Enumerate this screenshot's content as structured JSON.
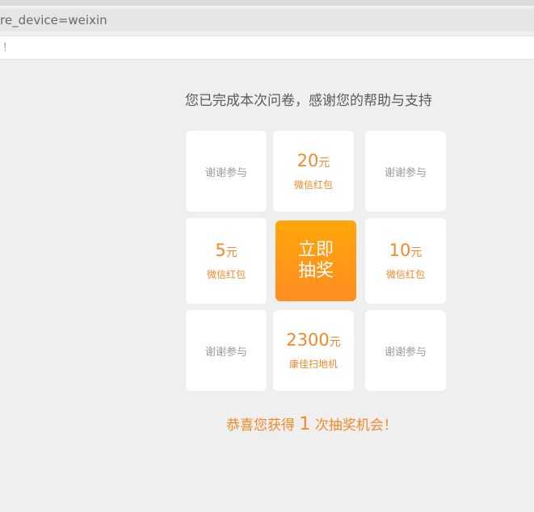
{
  "browser": {
    "url_fragment": "re_device=weixin",
    "info_text": "！"
  },
  "survey": {
    "title": "您已完成本次问卷，感谢您的帮助与支持"
  },
  "lottery": {
    "cells": {
      "top_left": {
        "text": "谢谢参与"
      },
      "top_middle": {
        "amount": "20",
        "unit": "元",
        "label": "微信红包"
      },
      "top_right": {
        "text": "谢谢参与"
      },
      "middle_left": {
        "amount": "5",
        "unit": "元",
        "label": "微信红包"
      },
      "middle_right": {
        "amount": "10",
        "unit": "元",
        "label": "微信红包"
      },
      "bottom_left": {
        "text": "谢谢参与"
      },
      "bottom_middle": {
        "amount": "2300",
        "unit": "元",
        "label": "康佳扫地机"
      },
      "bottom_right": {
        "text": "谢谢参与"
      }
    },
    "draw_button": {
      "line1": "立即",
      "line2": "抽奖"
    },
    "chance": {
      "prefix": "恭喜您获得",
      "count": "1",
      "suffix": "次抽奖机会！"
    }
  },
  "colors": {
    "accent": "#f08a2a",
    "button_top": "#ffa60a",
    "button_bottom": "#ff8d22",
    "background": "#efefef"
  }
}
